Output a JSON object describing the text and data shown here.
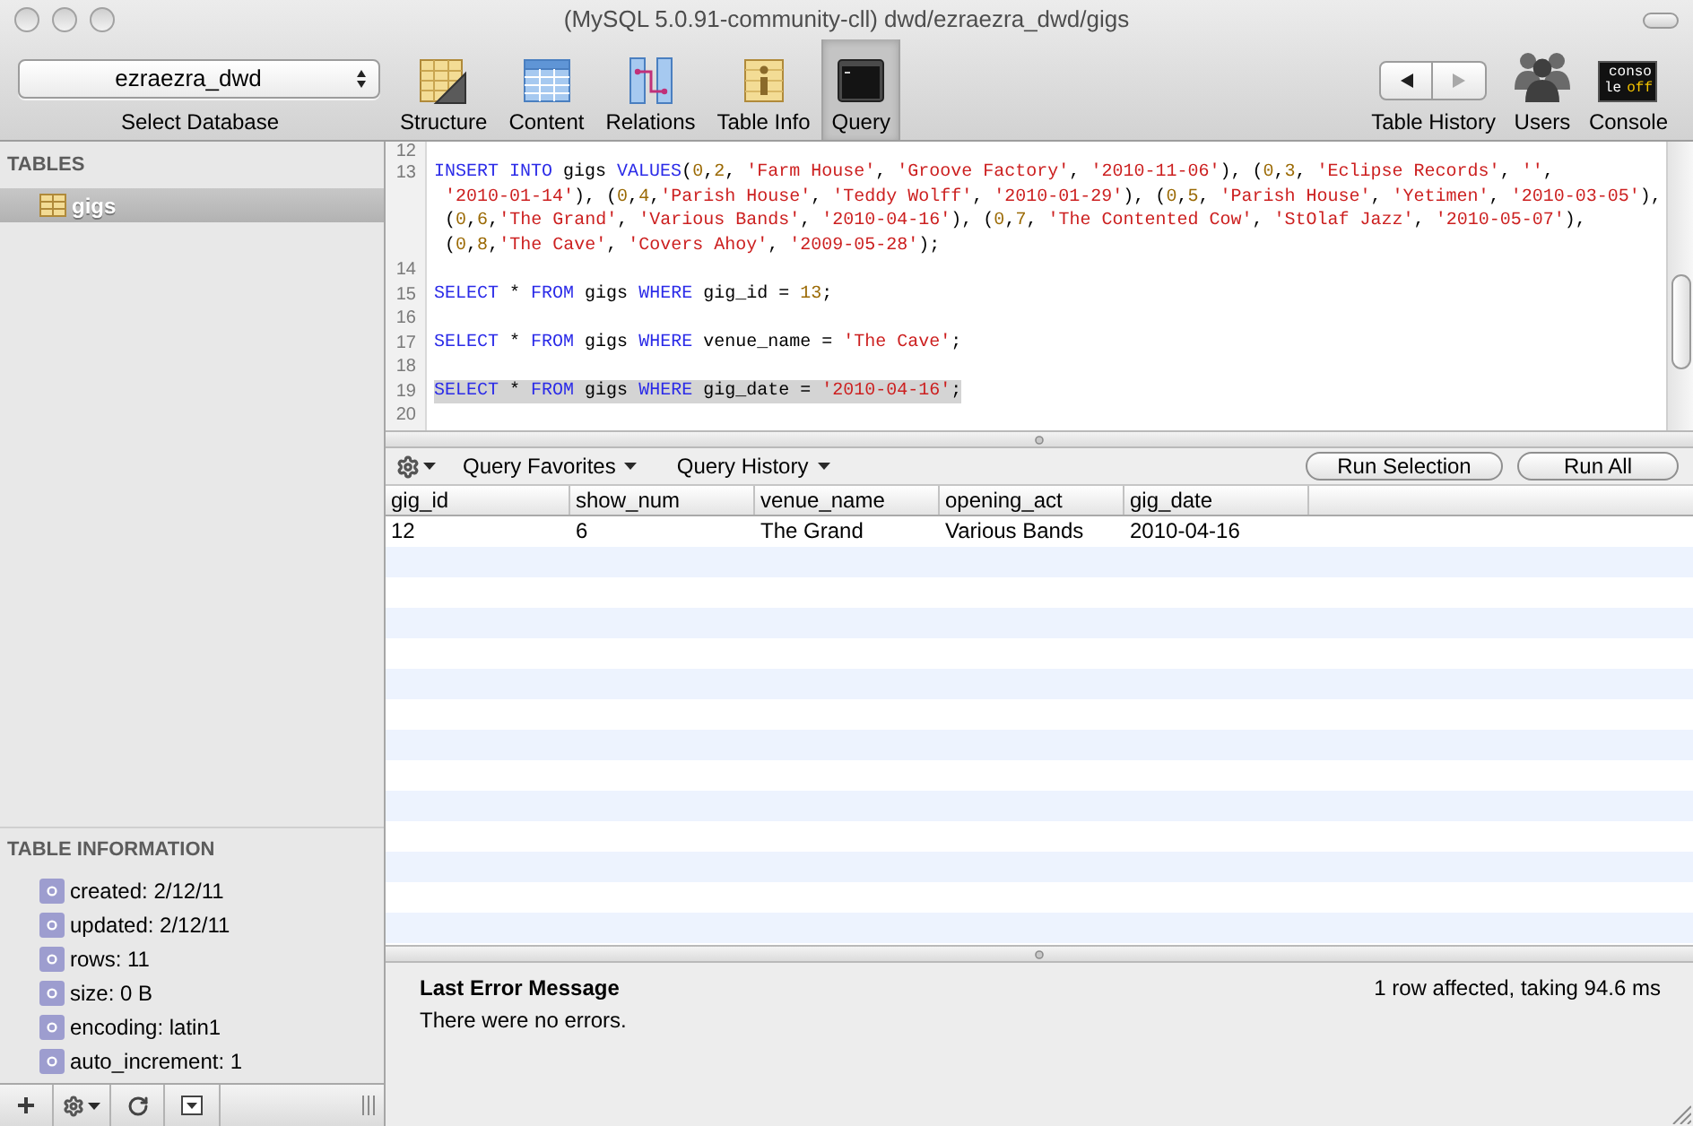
{
  "window": {
    "title": "(MySQL 5.0.91-community-cll) dwd/ezraezra_dwd/gigs"
  },
  "toolbar": {
    "database": {
      "value": "ezraezra_dwd",
      "label": "Select Database"
    },
    "items": [
      {
        "kind": "structure",
        "label": "Structure",
        "selected": false
      },
      {
        "kind": "content",
        "label": "Content",
        "selected": false
      },
      {
        "kind": "relations",
        "label": "Relations",
        "selected": false
      },
      {
        "kind": "info",
        "label": "Table Info",
        "selected": false
      },
      {
        "kind": "query",
        "label": "Query",
        "selected": true
      }
    ],
    "table_history": {
      "label": "Table History",
      "back_disabled": false,
      "forward_disabled": true
    },
    "users": {
      "label": "Users"
    },
    "console": {
      "label": "Console",
      "badge_lines": [
        "conso",
        "le"
      ],
      "badge_highlight": "off"
    }
  },
  "sidebar": {
    "tables": {
      "title": "TABLES",
      "items": [
        {
          "name": "gigs",
          "selected": true
        }
      ]
    },
    "table_information": {
      "title": "TABLE INFORMATION",
      "items": [
        "created: 2/12/11",
        "updated: 2/12/11",
        "rows: 11",
        "size: 0 B",
        "encoding: latin1",
        "auto_increment: 1"
      ]
    }
  },
  "editor": {
    "lines": [
      {
        "number": "12",
        "selected": false
      },
      {
        "number": "13",
        "selected": false,
        "rows": [
          {
            "tokens": [
              {
                "kind": "keyword",
                "text": "INSERT INTO"
              },
              {
                "kind": "plain",
                "text": " gigs "
              },
              {
                "kind": "keyword",
                "text": "VALUES"
              },
              {
                "kind": "plain",
                "text": "("
              },
              {
                "kind": "number",
                "text": "0"
              },
              {
                "kind": "plain",
                "text": ","
              },
              {
                "kind": "number",
                "text": "2"
              },
              {
                "kind": "plain",
                "text": ", "
              },
              {
                "kind": "string",
                "text": "'Farm House'"
              },
              {
                "kind": "plain",
                "text": ", "
              },
              {
                "kind": "string",
                "text": "'Groove Factory'"
              },
              {
                "kind": "plain",
                "text": ", "
              },
              {
                "kind": "string",
                "text": "'2010-11-06'"
              },
              {
                "kind": "plain",
                "text": "), ("
              },
              {
                "kind": "number",
                "text": "0"
              },
              {
                "kind": "plain",
                "text": ","
              },
              {
                "kind": "number",
                "text": "3"
              },
              {
                "kind": "plain",
                "text": ", "
              },
              {
                "kind": "string",
                "text": "'Eclipse Records'"
              },
              {
                "kind": "plain",
                "text": ", "
              },
              {
                "kind": "string",
                "text": "''"
              },
              {
                "kind": "plain",
                "text": ","
              }
            ]
          },
          {
            "tokens": [
              {
                "kind": "string",
                "text": "'2010-01-14'"
              },
              {
                "kind": "plain",
                "text": "), ("
              },
              {
                "kind": "number",
                "text": "0"
              },
              {
                "kind": "plain",
                "text": ","
              },
              {
                "kind": "number",
                "text": "4"
              },
              {
                "kind": "plain",
                "text": ","
              },
              {
                "kind": "string",
                "text": "'Parish House'"
              },
              {
                "kind": "plain",
                "text": ", "
              },
              {
                "kind": "string",
                "text": "'Teddy Wolff'"
              },
              {
                "kind": "plain",
                "text": ", "
              },
              {
                "kind": "string",
                "text": "'2010-01-29'"
              },
              {
                "kind": "plain",
                "text": "), ("
              },
              {
                "kind": "number",
                "text": "0"
              },
              {
                "kind": "plain",
                "text": ","
              },
              {
                "kind": "number",
                "text": "5"
              },
              {
                "kind": "plain",
                "text": ", "
              },
              {
                "kind": "string",
                "text": "'Parish House'"
              },
              {
                "kind": "plain",
                "text": ", "
              },
              {
                "kind": "string",
                "text": "'Yetimen'"
              },
              {
                "kind": "plain",
                "text": ", "
              },
              {
                "kind": "string",
                "text": "'2010-03-05'"
              },
              {
                "kind": "plain",
                "text": "),"
              }
            ]
          },
          {
            "tokens": [
              {
                "kind": "plain",
                "text": "("
              },
              {
                "kind": "number",
                "text": "0"
              },
              {
                "kind": "plain",
                "text": ","
              },
              {
                "kind": "number",
                "text": "6"
              },
              {
                "kind": "plain",
                "text": ","
              },
              {
                "kind": "string",
                "text": "'The Grand'"
              },
              {
                "kind": "plain",
                "text": ", "
              },
              {
                "kind": "string",
                "text": "'Various Bands'"
              },
              {
                "kind": "plain",
                "text": ", "
              },
              {
                "kind": "string",
                "text": "'2010-04-16'"
              },
              {
                "kind": "plain",
                "text": "), ("
              },
              {
                "kind": "number",
                "text": "0"
              },
              {
                "kind": "plain",
                "text": ","
              },
              {
                "kind": "number",
                "text": "7"
              },
              {
                "kind": "plain",
                "text": ", "
              },
              {
                "kind": "string",
                "text": "'The Contented Cow'"
              },
              {
                "kind": "plain",
                "text": ", "
              },
              {
                "kind": "string",
                "text": "'StOlaf Jazz'"
              },
              {
                "kind": "plain",
                "text": ", "
              },
              {
                "kind": "string",
                "text": "'2010-05-07'"
              },
              {
                "kind": "plain",
                "text": "),"
              }
            ]
          },
          {
            "tokens": [
              {
                "kind": "plain",
                "text": "("
              },
              {
                "kind": "number",
                "text": "0"
              },
              {
                "kind": "plain",
                "text": ","
              },
              {
                "kind": "number",
                "text": "8"
              },
              {
                "kind": "plain",
                "text": ","
              },
              {
                "kind": "string",
                "text": "'The Cave'"
              },
              {
                "kind": "plain",
                "text": ", "
              },
              {
                "kind": "string",
                "text": "'Covers Ahoy'"
              },
              {
                "kind": "plain",
                "text": ", "
              },
              {
                "kind": "string",
                "text": "'2009-05-28'"
              },
              {
                "kind": "plain",
                "text": ");"
              }
            ]
          }
        ]
      },
      {
        "number": "14",
        "selected": false
      },
      {
        "number": "15",
        "selected": false,
        "rows": [
          {
            "tokens": [
              {
                "kind": "keyword",
                "text": "SELECT"
              },
              {
                "kind": "plain",
                "text": " * "
              },
              {
                "kind": "keyword",
                "text": "FROM"
              },
              {
                "kind": "plain",
                "text": " gigs "
              },
              {
                "kind": "keyword",
                "text": "WHERE"
              },
              {
                "kind": "plain",
                "text": " gig_id = "
              },
              {
                "kind": "number",
                "text": "13"
              },
              {
                "kind": "plain",
                "text": ";"
              }
            ]
          }
        ]
      },
      {
        "number": "16",
        "selected": false
      },
      {
        "number": "17",
        "selected": false,
        "rows": [
          {
            "tokens": [
              {
                "kind": "keyword",
                "text": "SELECT"
              },
              {
                "kind": "plain",
                "text": " * "
              },
              {
                "kind": "keyword",
                "text": "FROM"
              },
              {
                "kind": "plain",
                "text": " gigs "
              },
              {
                "kind": "keyword",
                "text": "WHERE"
              },
              {
                "kind": "plain",
                "text": " venue_name = "
              },
              {
                "kind": "string",
                "text": "'The Cave'"
              },
              {
                "kind": "plain",
                "text": ";"
              }
            ]
          }
        ]
      },
      {
        "number": "18",
        "selected": false
      },
      {
        "number": "19",
        "selected": true,
        "rows": [
          {
            "tokens": [
              {
                "kind": "keyword",
                "text": "SELECT"
              },
              {
                "kind": "plain",
                "text": " * "
              },
              {
                "kind": "keyword",
                "text": "FROM"
              },
              {
                "kind": "plain",
                "text": " gigs "
              },
              {
                "kind": "keyword",
                "text": "WHERE"
              },
              {
                "kind": "plain",
                "text": " gig_date = "
              },
              {
                "kind": "string",
                "text": "'2010-04-16'"
              },
              {
                "kind": "plain",
                "text": ";"
              }
            ]
          }
        ]
      },
      {
        "number": "20",
        "selected": false
      }
    ]
  },
  "results": {
    "toolbar": {
      "menus": [
        "Query Favorites",
        "Query History"
      ],
      "buttons": [
        "Run Selection",
        "Run All"
      ]
    },
    "table": {
      "columns": [
        "gig_id",
        "show_num",
        "venue_name",
        "opening_act",
        "gig_date"
      ],
      "rows": [
        [
          "12",
          "6",
          "The Grand",
          "Various Bands",
          "2010-04-16"
        ]
      ]
    }
  },
  "messages": {
    "title": "Last Error Message",
    "text": "There were no errors.",
    "status": "1 row affected, taking 94.6 ms"
  }
}
